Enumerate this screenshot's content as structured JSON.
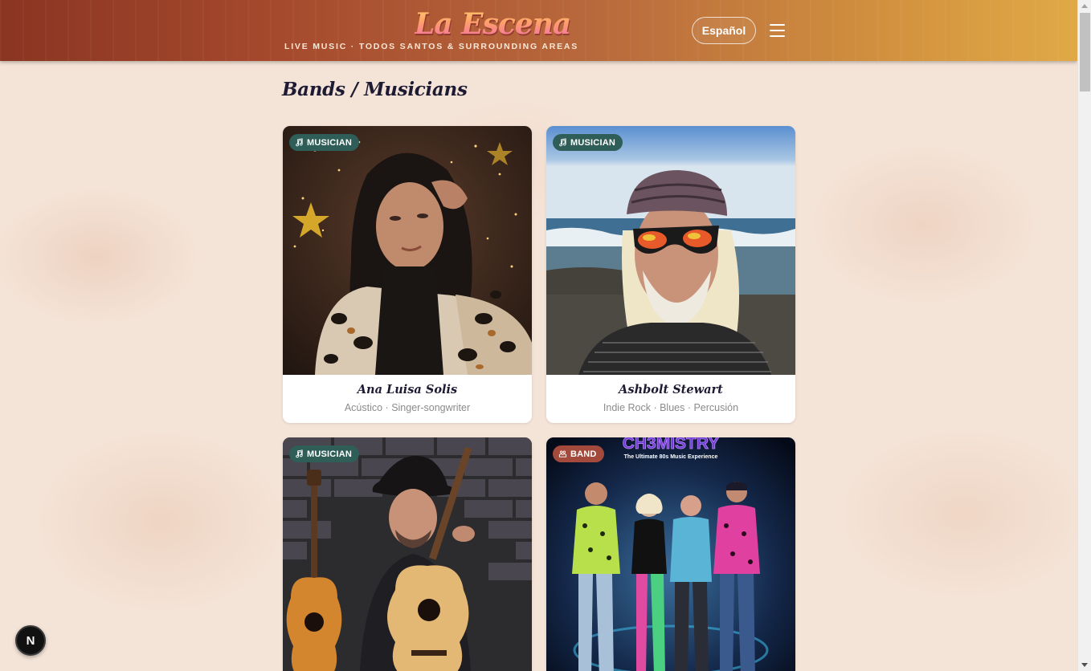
{
  "header": {
    "logo_text": "La Escena",
    "tagline": "LIVE MUSIC · TODOS SANTOS & SURROUNDING AREAS",
    "language_button": "Español",
    "menu_icon": "hamburger-menu-icon"
  },
  "colors": {
    "header_start": "#8a3522",
    "header_end": "#e0a947",
    "musician_badge": "#2f5d57",
    "band_badge": "#a44a3c",
    "title_text": "#1d1a33",
    "page_background": "#f4e3d7"
  },
  "main": {
    "section_title": "Bands / Musicians",
    "cards": [
      {
        "badge": "MUSICIAN",
        "badge_icon": "music-note-icon",
        "name": "Ana Luisa Solis",
        "subtitle": "Acústico · Singer-songwriter",
        "photo": "woman-leopard-print-photo"
      },
      {
        "badge": "MUSICIAN",
        "badge_icon": "music-note-icon",
        "name": "Ashbolt Stewart",
        "subtitle": "Indie Rock · Blues · Percusión",
        "photo": "man-sunglasses-beach-photo"
      },
      {
        "badge": "MUSICIAN",
        "badge_icon": "music-note-icon",
        "name": "",
        "subtitle": "",
        "photo": "man-guitars-brick-wall-photo"
      },
      {
        "badge": "BAND",
        "badge_icon": "band-stage-icon",
        "name": "",
        "subtitle": "",
        "photo": "chemistry-band-poster-photo",
        "poster_title": "CH3MISTRY",
        "poster_subtitle": "The Ultimate 80s Music Experience"
      }
    ]
  },
  "dev_tools": {
    "next_button_label": "N"
  }
}
